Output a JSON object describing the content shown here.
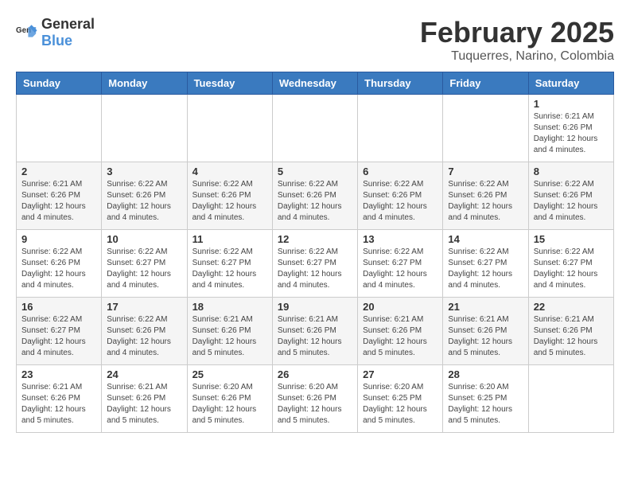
{
  "header": {
    "logo_general": "General",
    "logo_blue": "Blue",
    "month_year": "February 2025",
    "location": "Tuquerres, Narino, Colombia"
  },
  "weekdays": [
    "Sunday",
    "Monday",
    "Tuesday",
    "Wednesday",
    "Thursday",
    "Friday",
    "Saturday"
  ],
  "weeks": [
    [
      {
        "day": "",
        "info": ""
      },
      {
        "day": "",
        "info": ""
      },
      {
        "day": "",
        "info": ""
      },
      {
        "day": "",
        "info": ""
      },
      {
        "day": "",
        "info": ""
      },
      {
        "day": "",
        "info": ""
      },
      {
        "day": "1",
        "info": "Sunrise: 6:21 AM\nSunset: 6:26 PM\nDaylight: 12 hours\nand 4 minutes."
      }
    ],
    [
      {
        "day": "2",
        "info": "Sunrise: 6:21 AM\nSunset: 6:26 PM\nDaylight: 12 hours\nand 4 minutes."
      },
      {
        "day": "3",
        "info": "Sunrise: 6:22 AM\nSunset: 6:26 PM\nDaylight: 12 hours\nand 4 minutes."
      },
      {
        "day": "4",
        "info": "Sunrise: 6:22 AM\nSunset: 6:26 PM\nDaylight: 12 hours\nand 4 minutes."
      },
      {
        "day": "5",
        "info": "Sunrise: 6:22 AM\nSunset: 6:26 PM\nDaylight: 12 hours\nand 4 minutes."
      },
      {
        "day": "6",
        "info": "Sunrise: 6:22 AM\nSunset: 6:26 PM\nDaylight: 12 hours\nand 4 minutes."
      },
      {
        "day": "7",
        "info": "Sunrise: 6:22 AM\nSunset: 6:26 PM\nDaylight: 12 hours\nand 4 minutes."
      },
      {
        "day": "8",
        "info": "Sunrise: 6:22 AM\nSunset: 6:26 PM\nDaylight: 12 hours\nand 4 minutes."
      }
    ],
    [
      {
        "day": "9",
        "info": "Sunrise: 6:22 AM\nSunset: 6:26 PM\nDaylight: 12 hours\nand 4 minutes."
      },
      {
        "day": "10",
        "info": "Sunrise: 6:22 AM\nSunset: 6:27 PM\nDaylight: 12 hours\nand 4 minutes."
      },
      {
        "day": "11",
        "info": "Sunrise: 6:22 AM\nSunset: 6:27 PM\nDaylight: 12 hours\nand 4 minutes."
      },
      {
        "day": "12",
        "info": "Sunrise: 6:22 AM\nSunset: 6:27 PM\nDaylight: 12 hours\nand 4 minutes."
      },
      {
        "day": "13",
        "info": "Sunrise: 6:22 AM\nSunset: 6:27 PM\nDaylight: 12 hours\nand 4 minutes."
      },
      {
        "day": "14",
        "info": "Sunrise: 6:22 AM\nSunset: 6:27 PM\nDaylight: 12 hours\nand 4 minutes."
      },
      {
        "day": "15",
        "info": "Sunrise: 6:22 AM\nSunset: 6:27 PM\nDaylight: 12 hours\nand 4 minutes."
      }
    ],
    [
      {
        "day": "16",
        "info": "Sunrise: 6:22 AM\nSunset: 6:27 PM\nDaylight: 12 hours\nand 4 minutes."
      },
      {
        "day": "17",
        "info": "Sunrise: 6:22 AM\nSunset: 6:26 PM\nDaylight: 12 hours\nand 4 minutes."
      },
      {
        "day": "18",
        "info": "Sunrise: 6:21 AM\nSunset: 6:26 PM\nDaylight: 12 hours\nand 5 minutes."
      },
      {
        "day": "19",
        "info": "Sunrise: 6:21 AM\nSunset: 6:26 PM\nDaylight: 12 hours\nand 5 minutes."
      },
      {
        "day": "20",
        "info": "Sunrise: 6:21 AM\nSunset: 6:26 PM\nDaylight: 12 hours\nand 5 minutes."
      },
      {
        "day": "21",
        "info": "Sunrise: 6:21 AM\nSunset: 6:26 PM\nDaylight: 12 hours\nand 5 minutes."
      },
      {
        "day": "22",
        "info": "Sunrise: 6:21 AM\nSunset: 6:26 PM\nDaylight: 12 hours\nand 5 minutes."
      }
    ],
    [
      {
        "day": "23",
        "info": "Sunrise: 6:21 AM\nSunset: 6:26 PM\nDaylight: 12 hours\nand 5 minutes."
      },
      {
        "day": "24",
        "info": "Sunrise: 6:21 AM\nSunset: 6:26 PM\nDaylight: 12 hours\nand 5 minutes."
      },
      {
        "day": "25",
        "info": "Sunrise: 6:20 AM\nSunset: 6:26 PM\nDaylight: 12 hours\nand 5 minutes."
      },
      {
        "day": "26",
        "info": "Sunrise: 6:20 AM\nSunset: 6:26 PM\nDaylight: 12 hours\nand 5 minutes."
      },
      {
        "day": "27",
        "info": "Sunrise: 6:20 AM\nSunset: 6:25 PM\nDaylight: 12 hours\nand 5 minutes."
      },
      {
        "day": "28",
        "info": "Sunrise: 6:20 AM\nSunset: 6:25 PM\nDaylight: 12 hours\nand 5 minutes."
      },
      {
        "day": "",
        "info": ""
      }
    ]
  ]
}
